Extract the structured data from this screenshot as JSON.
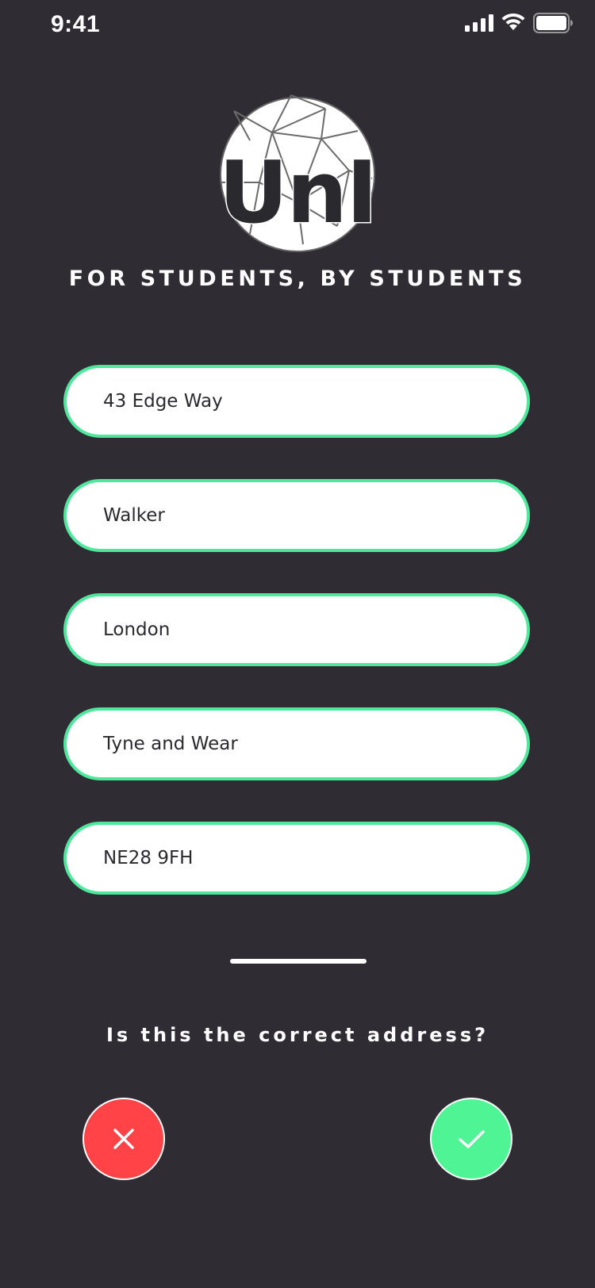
{
  "status_bar": {
    "time": "9:41"
  },
  "logo": {
    "wordmark": "UnI",
    "icon": "geodesic-globe-logo"
  },
  "tagline": "FOR STUDENTS, BY STUDENTS",
  "address": {
    "line1": "43 Edge Way",
    "line2": "Walker",
    "city": "London",
    "county": "Tyne and Wear",
    "postcode": "NE28 9FH"
  },
  "prompt": "Is this the correct address?",
  "actions": {
    "reject_icon": "close-icon",
    "confirm_icon": "checkmark-icon"
  },
  "colors": {
    "background": "#2f2d33",
    "accent": "#4ee89c",
    "reject": "#ff4347",
    "confirm": "#4ff494"
  }
}
